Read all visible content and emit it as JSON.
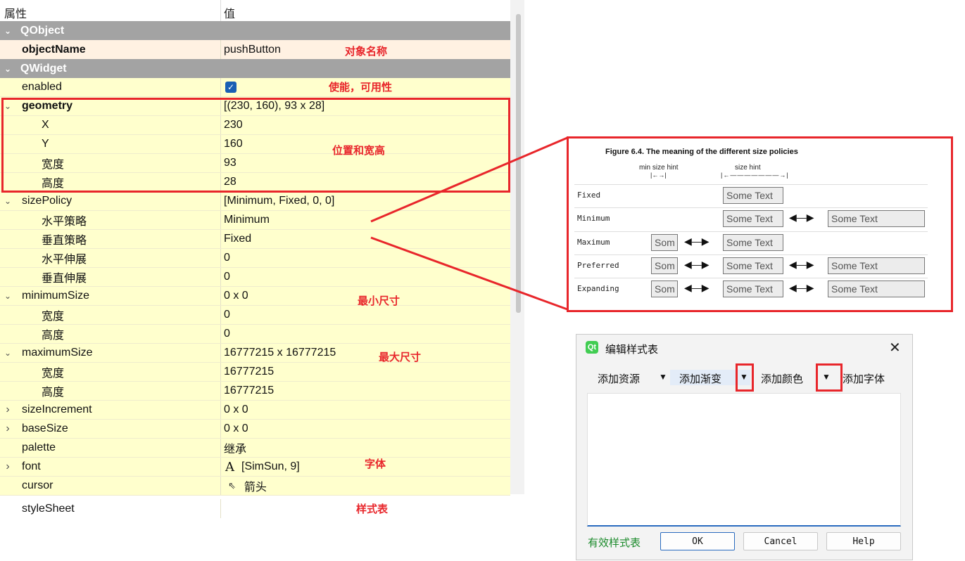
{
  "property_editor": {
    "header": {
      "property": "属性",
      "value": "值"
    },
    "rows": [
      {
        "kind": "section",
        "name": "QObject",
        "value": ""
      },
      {
        "kind": "o",
        "name": "objectName",
        "value": "pushButton",
        "bold": true
      },
      {
        "kind": "section",
        "name": "QWidget",
        "value": ""
      },
      {
        "kind": "y",
        "name": "enabled",
        "value": "",
        "checkbox": true
      },
      {
        "kind": "y",
        "name": "geometry",
        "value": "[(230, 160), 93 x 28]",
        "bold": true,
        "expander": "expanded"
      },
      {
        "kind": "y",
        "name": "X",
        "value": "230",
        "indent": 2
      },
      {
        "kind": "y",
        "name": "Y",
        "value": "160",
        "indent": 2
      },
      {
        "kind": "y",
        "name": "宽度",
        "value": "93",
        "indent": 2
      },
      {
        "kind": "y",
        "name": "高度",
        "value": "28",
        "indent": 2
      },
      {
        "kind": "y",
        "name": "sizePolicy",
        "value": "[Minimum, Fixed, 0, 0]",
        "expander": "expanded"
      },
      {
        "kind": "y",
        "name": "水平策略",
        "value": "Minimum",
        "indent": 2
      },
      {
        "kind": "y",
        "name": "垂直策略",
        "value": "Fixed",
        "indent": 2
      },
      {
        "kind": "y",
        "name": "水平伸展",
        "value": "0",
        "indent": 2
      },
      {
        "kind": "y",
        "name": "垂直伸展",
        "value": "0",
        "indent": 2
      },
      {
        "kind": "y",
        "name": "minimumSize",
        "value": "0 x 0",
        "expander": "expanded"
      },
      {
        "kind": "y",
        "name": "宽度",
        "value": "0",
        "indent": 2
      },
      {
        "kind": "y",
        "name": "高度",
        "value": "0",
        "indent": 2
      },
      {
        "kind": "y",
        "name": "maximumSize",
        "value": "16777215 x 16777215",
        "expander": "expanded"
      },
      {
        "kind": "y",
        "name": "宽度",
        "value": "16777215",
        "indent": 2
      },
      {
        "kind": "y",
        "name": "高度",
        "value": "16777215",
        "indent": 2
      },
      {
        "kind": "y",
        "name": "sizeIncrement",
        "value": "0 x 0",
        "expander": "collapsed"
      },
      {
        "kind": "y",
        "name": "baseSize",
        "value": "0 x 0",
        "expander": "collapsed"
      },
      {
        "kind": "y",
        "name": "palette",
        "value": "继承"
      },
      {
        "kind": "y",
        "name": "font",
        "value": "[SimSun, 9]",
        "expander": "collapsed",
        "icon": "font-icon"
      },
      {
        "kind": "y",
        "name": "cursor",
        "value": "箭头",
        "icon": "arrow-cursor-icon"
      },
      {
        "kind": "w",
        "name": "styleSheet",
        "value": ""
      }
    ]
  },
  "annotations": {
    "object_name": "对象名称",
    "enabled": "使能，可用性",
    "geometry": "位置和宽高",
    "minimum_size": "最小尺寸",
    "maximum_size": "最大尺寸",
    "font": "字体",
    "stylesheet": "样式表"
  },
  "figure": {
    "title": "Figure 6.4. The meaning of the different size policies",
    "min_size_hint": "min size hint",
    "size_hint": "size hint",
    "rows": [
      {
        "policy": "Fixed",
        "boxes": [
          "",
          "Some Text",
          ""
        ]
      },
      {
        "policy": "Minimum",
        "boxes": [
          "",
          "Some Text",
          "Some Text"
        ]
      },
      {
        "policy": "Maximum",
        "boxes": [
          "Som",
          "Some Text",
          ""
        ]
      },
      {
        "policy": "Preferred",
        "boxes": [
          "Som",
          "Some Text",
          "Some Text"
        ]
      },
      {
        "policy": "Expanding",
        "boxes": [
          "Som",
          "Some Text",
          "Some Text"
        ]
      }
    ]
  },
  "dialog": {
    "title": "编辑样式表",
    "logo": "Qt",
    "toolbar": {
      "add_resource": "添加资源",
      "add_gradient": "添加渐变",
      "add_color": "添加颜色",
      "add_font": "添加字体"
    },
    "status": "有效样式表",
    "ok": "OK",
    "cancel": "Cancel",
    "help": "Help"
  },
  "icons": {
    "section_expanded": "chevron-down-icon",
    "collapsed": "chevron-right-icon",
    "checkbox": "checkmark-icon",
    "dropdown": "caret-down-icon",
    "close": "close-icon"
  },
  "colors": {
    "annotation": "#e8262b",
    "section_bg": "#a3a3a3",
    "row_bg": "#ffffcd",
    "object_row_bg": "#fff1e2",
    "valid_text": "#1a8a2a",
    "accent": "#2a6bbf"
  }
}
